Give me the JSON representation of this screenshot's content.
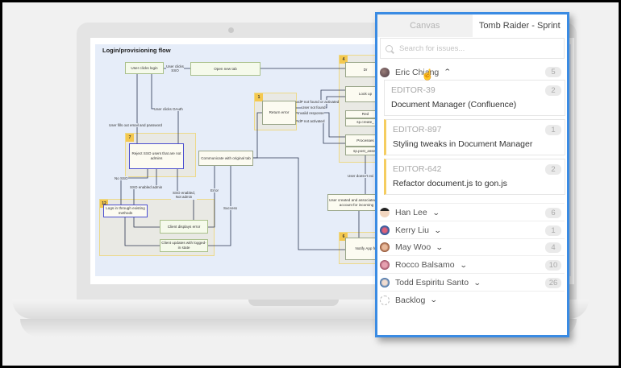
{
  "diagram": {
    "title": "Login/provisioning flow",
    "boxes": {
      "user_clicks_login": "User clicks login",
      "open_new_tab": "Open new tab",
      "drop": "Dr",
      "return_error": "Return error",
      "look_up": "Look up",
      "red": "Red",
      "sp_create": "sp.create_",
      "processes": "Processes",
      "sp_post_assert": "sp.post_assert",
      "reject_sso": "Reject SSO users that are not admins",
      "communicate": "Communicate with original tab",
      "logs_in": "Logs in through existing methods",
      "client_error": "Client displays error",
      "client_updates": "Client updates with logged-in state",
      "user_created": "User created and associated with account for incoming",
      "notify_app": "Notify App fr"
    },
    "badges": {
      "g4": "4",
      "g1": "1",
      "g7": "7",
      "g12": "12",
      "g6": "6"
    },
    "labels": {
      "user_clicks_sso": "User clicks SSO",
      "user_clicks_oauth": "User clicks OAuth",
      "fills_out": "User fills out email and password",
      "idp_not_found": "IdP not found or activated",
      "user_not_found": "User not found",
      "invalid_response": "Invalid response",
      "idp_not_activated": "IdP not activated",
      "no_sso": "No SSO",
      "sso_enabled_admin": "SSO enabled admin",
      "sso_enabled_not_admin": "SSO enabled, Not admin",
      "error": "Error",
      "success": "Success",
      "user_doesnt_exist": "User doesn't exi"
    }
  },
  "panel": {
    "tabs": [
      {
        "label": "Canvas",
        "active": false
      },
      {
        "label": "Tomb Raider - Sprint",
        "active": true
      }
    ],
    "search_placeholder": "Search for issues...",
    "expanded": {
      "name": "Eric Chiang",
      "count": "5",
      "issues": [
        {
          "key": "EDITOR-39",
          "title": "Document Manager (Confluence)",
          "count": "2",
          "flagged": false
        },
        {
          "key": "EDITOR-897",
          "title": "Styling tweaks in Document Manager",
          "count": "1",
          "flagged": true
        },
        {
          "key": "EDITOR-642",
          "title": "Refactor document.js to gon.js",
          "count": "2",
          "flagged": true
        }
      ]
    },
    "assignees": [
      {
        "name": "Han Lee",
        "count": "6"
      },
      {
        "name": "Kerry Liu",
        "count": "1"
      },
      {
        "name": "May Woo",
        "count": "4"
      },
      {
        "name": "Rocco Balsamo",
        "count": "10"
      },
      {
        "name": "Todd Espiritu Santo",
        "count": "26"
      },
      {
        "name": "Backlog"
      }
    ],
    "accent": "#3a8be3",
    "flag_color": "#f5cd5f"
  }
}
